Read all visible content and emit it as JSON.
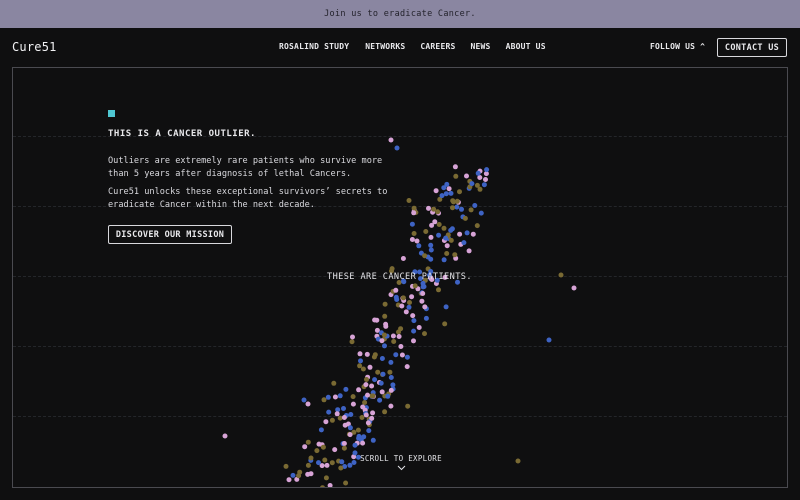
{
  "banner": {
    "text": "Join us to eradicate Cancer."
  },
  "nav": {
    "logo": "Cure51",
    "links": [
      "ROSALIND STUDY",
      "NETWORKS",
      "CAREERS",
      "NEWS",
      "ABOUT US"
    ],
    "follow": "FOLLOW US",
    "contact": "CONTACT US"
  },
  "hero": {
    "headline": "THIS IS A CANCER OUTLIER.",
    "para1": "Outliers are extremely rare patients who survive more than 5 years after diagnosis of lethal Cancers.",
    "para2": "Cure51 unlocks these exceptional survivors’ secrets to eradicate Cancer within the next decade.",
    "cta": "DISCOVER OUR MISSION",
    "patients_label": "THESE ARE CANCER PATIENTS.",
    "scroll": "SCROLL TO EXPLORE"
  },
  "colors": {
    "accent_square": "#4fc7d2",
    "dot_pink": "#d7a3d6",
    "dot_blue": "#3e63c4",
    "dot_olive": "#7a6a33",
    "banner_bg": "#8a86a1"
  }
}
